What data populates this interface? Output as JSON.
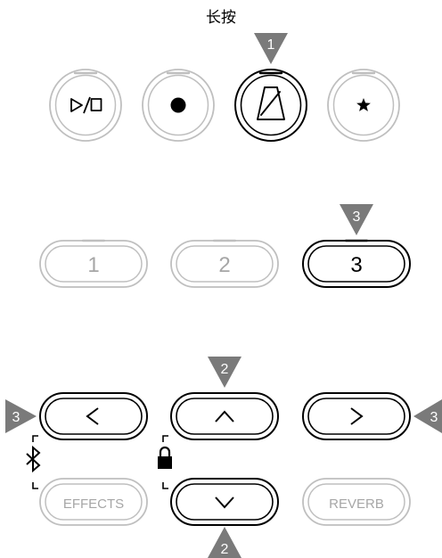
{
  "instruction": {
    "long_press_label": "长按"
  },
  "step_markers": {
    "metronome": "1",
    "memory_3": "3",
    "up": "2",
    "left": "3",
    "right": "3",
    "down": "2"
  },
  "transport_buttons": [
    {
      "name": "play-stop",
      "icon": "play-stop-icon"
    },
    {
      "name": "record",
      "icon": "record-icon"
    },
    {
      "name": "metronome",
      "icon": "metronome-icon",
      "active": true
    },
    {
      "name": "favorite",
      "icon": "star-icon"
    }
  ],
  "memory_buttons": {
    "one": "1",
    "two": "2",
    "three": "3"
  },
  "function_buttons": {
    "effects": "EFFECTS",
    "reverb": "REVERB"
  },
  "side_icons": {
    "bluetooth": "bluetooth-icon",
    "lock": "lock-icon"
  },
  "colors": {
    "active_outline": "#000000",
    "inactive_outline": "#bfbfbf",
    "marker_fill": "#7a7a7a",
    "marker_text": "#ffffff",
    "inactive_text": "#a6a6a6"
  }
}
